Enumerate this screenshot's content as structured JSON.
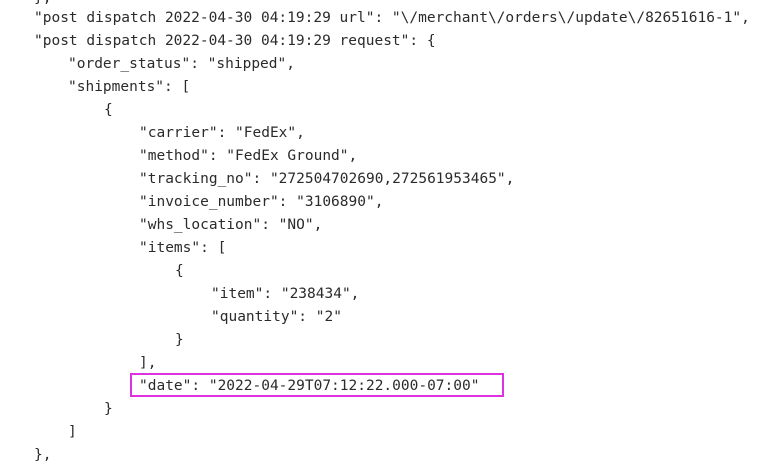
{
  "highlight": {
    "color": "#dd32e0",
    "target": "date"
  },
  "code": {
    "lines": [
      {
        "text": "},"
      },
      {
        "text": "\"post dispatch 2022-04-30 04:19:29 url\": \"\\/merchant\\/orders\\/update\\/82651616-1\","
      },
      {
        "text": "\"post dispatch 2022-04-30 04:19:29 request\": {"
      },
      {
        "text": "\"order_status\": \"shipped\","
      },
      {
        "text": "\"shipments\": ["
      },
      {
        "text": "{"
      },
      {
        "text": "\"carrier\": \"FedEx\","
      },
      {
        "text": "\"method\": \"FedEx Ground\","
      },
      {
        "text": "\"tracking_no\": \"272504702690,272561953465\","
      },
      {
        "text": "\"invoice_number\": \"3106890\","
      },
      {
        "text": "\"whs_location\": \"NO\","
      },
      {
        "text": "\"items\": ["
      },
      {
        "text": "{"
      },
      {
        "text": "\"item\": \"238434\","
      },
      {
        "text": "\"quantity\": \"2\""
      },
      {
        "text": "}"
      },
      {
        "text": "],"
      },
      {
        "text": "\"date\": \"2022-04-29T07:12:22.000-07:00\""
      },
      {
        "text": "}"
      },
      {
        "text": "]"
      },
      {
        "text": "},"
      }
    ]
  }
}
